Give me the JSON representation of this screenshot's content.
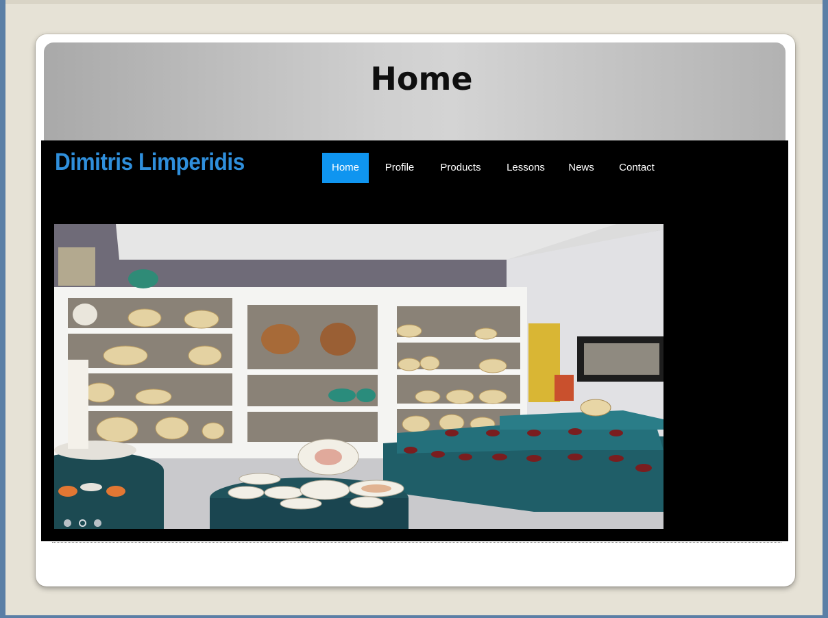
{
  "page": {
    "title": "Home"
  },
  "site": {
    "brand": "Dimitris Limperidis",
    "nav": [
      {
        "label": "Home",
        "active": true
      },
      {
        "label": "Profile",
        "active": false
      },
      {
        "label": "Products",
        "active": false
      },
      {
        "label": "Lessons",
        "active": false
      },
      {
        "label": "News",
        "active": false
      },
      {
        "label": "Contact",
        "active": false
      }
    ],
    "slider": {
      "image": "ceramics-gallery-photo",
      "slide_count": 3,
      "active_slide": 2
    }
  },
  "colors": {
    "brand": "#2f8fdc",
    "nav_active": "#0f95f0",
    "site_background": "#000000"
  }
}
